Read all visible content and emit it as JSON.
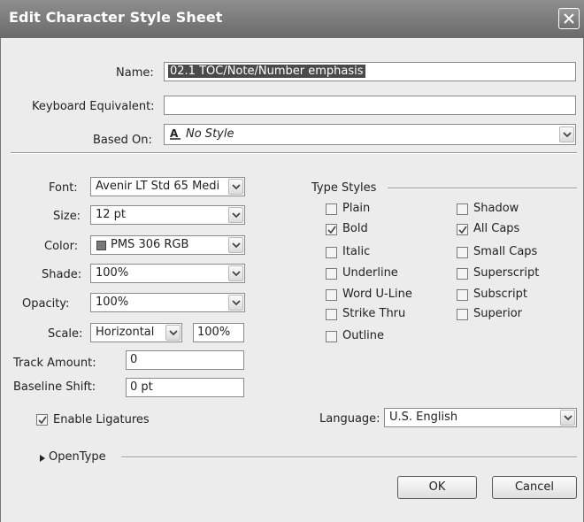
{
  "window": {
    "title": "Edit Character Style Sheet"
  },
  "name": {
    "label": "Name:",
    "value": "02.1 TOC/Note/Number emphasis"
  },
  "keyboard": {
    "label": "Keyboard Equivalent:",
    "value": ""
  },
  "based_on": {
    "label": "Based On:",
    "value": "No Style",
    "icon": "character-style-icon"
  },
  "font": {
    "label": "Font:",
    "value": "Avenir LT Std 65 Medi"
  },
  "size": {
    "label": "Size:",
    "value": "12 pt"
  },
  "color": {
    "label": "Color:",
    "value": "PMS 306 RGB",
    "swatch": "#7a7a7a"
  },
  "shade": {
    "label": "Shade:",
    "value": "100%"
  },
  "opacity": {
    "label": "Opacity:",
    "value": "100%"
  },
  "scale": {
    "label": "Scale:",
    "value": "Horizontal",
    "amount": "100%"
  },
  "track": {
    "label": "Track Amount:",
    "value": "0"
  },
  "baseline": {
    "label": "Baseline Shift:",
    "value": "0 pt"
  },
  "ligatures": {
    "label": "Enable Ligatures",
    "checked": true
  },
  "type_styles": {
    "heading": "Type Styles",
    "left": [
      {
        "label": "Plain",
        "checked": false
      },
      {
        "label": "Bold",
        "checked": true
      },
      {
        "label": "Italic",
        "checked": false
      },
      {
        "label": "Underline",
        "checked": false
      },
      {
        "label": "Word U-Line",
        "checked": false
      },
      {
        "label": "Strike Thru",
        "checked": false
      },
      {
        "label": "Outline",
        "checked": false
      }
    ],
    "right": [
      {
        "label": "Shadow",
        "checked": false
      },
      {
        "label": "All Caps",
        "checked": true
      },
      {
        "label": "Small Caps",
        "checked": false
      },
      {
        "label": "Superscript",
        "checked": false
      },
      {
        "label": "Subscript",
        "checked": false
      },
      {
        "label": "Superior",
        "checked": false
      }
    ]
  },
  "language": {
    "label": "Language:",
    "value": "U.S. English"
  },
  "opentype": {
    "label": "OpenType"
  },
  "buttons": {
    "ok": "OK",
    "cancel": "Cancel"
  }
}
